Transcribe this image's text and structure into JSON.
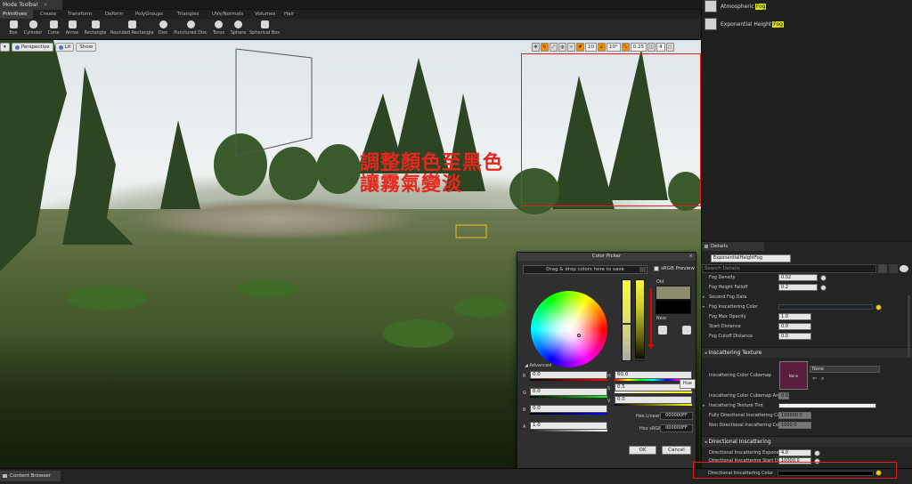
{
  "mode_toolbar": {
    "title": "Mode Toolbar",
    "categories": [
      "Primitives",
      "Create",
      "Transform",
      "Deform",
      "PolyGroups",
      "Triangles",
      "UVs/Normals",
      "Volumes",
      "Hair"
    ],
    "tools": [
      "Box",
      "Cylinder",
      "Cone",
      "Arrow",
      "Rectangle",
      "Rounded Rectangle",
      "Disc",
      "Punctured Disc",
      "Torus",
      "Sphere",
      "Spherical Box"
    ]
  },
  "viewport": {
    "perspective": "Perspective",
    "lit": "Lit",
    "show": "Show",
    "grid_snap": "10",
    "rot_snap": "10°",
    "scale_snap": "0.25",
    "cam_speed": "4"
  },
  "annotation": {
    "line1": "調整顏色至黑色",
    "line2": "讓霧氣變淡",
    "color": "#e5281e"
  },
  "color_picker": {
    "title": "Color Picker",
    "drag_hint": "Drag & drop colors here to save",
    "srgb_preview": "sRGB Preview",
    "old_label": "Old",
    "new_label": "New",
    "advanced_label": "Advanced",
    "r": "0.0",
    "g": "0.0",
    "b": "0.0",
    "a": "1.0",
    "h": "60.0",
    "s": "0.5",
    "v": "0.0",
    "hue_tooltip": "Hue",
    "hex_linear_label": "Hex Linear",
    "hex_linear": "000000FF",
    "hex_srgb_label": "Hex sRGB",
    "hex_srgb": "000000FF",
    "ok": "OK",
    "cancel": "Cancel",
    "old_color": "#8c8c6d",
    "new_color": "#000000"
  },
  "outliner": {
    "items": [
      {
        "name": "Atmospheric",
        "highlight": "Fog"
      },
      {
        "name": "Exponential Height ",
        "highlight": "Fog"
      }
    ]
  },
  "details": {
    "tab": "Details",
    "object_name": "ExponentialHeightFog",
    "search_placeholder": "Search Details",
    "fog_props": [
      {
        "label": "Fog Density",
        "value": "0.02"
      },
      {
        "label": "Fog Height Falloff",
        "value": "0.2"
      },
      {
        "label": "Second Fog Data",
        "value": ""
      },
      {
        "label": "Fog Inscattering Color",
        "value": ""
      },
      {
        "label": "Fog Max Opacity",
        "value": "1.0"
      },
      {
        "label": "Start Distance",
        "value": "0.0"
      },
      {
        "label": "Fog Cutoff Distance",
        "value": "0.0"
      }
    ],
    "section_inscattering_texture": "Inscattering Texture",
    "cubemap_label": "Inscattering Color Cubemap",
    "cubemap_thumb": "None",
    "cubemap_select": "None",
    "cubemap_angle_label": "Inscattering Color Cubemap Angle",
    "cubemap_angle": "0.0",
    "texture_tint_label": "Inscattering Texture Tint",
    "fully_dir_label": "Fully Directional Inscattering Color",
    "fully_dir_value": "100000.0",
    "non_dir_label": "Non Directional Inscattering Color",
    "non_dir_value": "1000.0",
    "section_directional": "Directional Inscattering",
    "dir_exponent_label": "Directional Inscattering Exponent",
    "dir_exponent": "4.0",
    "dir_start_label": "Directional Inscattering Start Dist",
    "dir_start": "10000.0",
    "dir_color_label": "Directional Inscattering Color"
  },
  "content_browser": {
    "tab": "Content Browser"
  }
}
